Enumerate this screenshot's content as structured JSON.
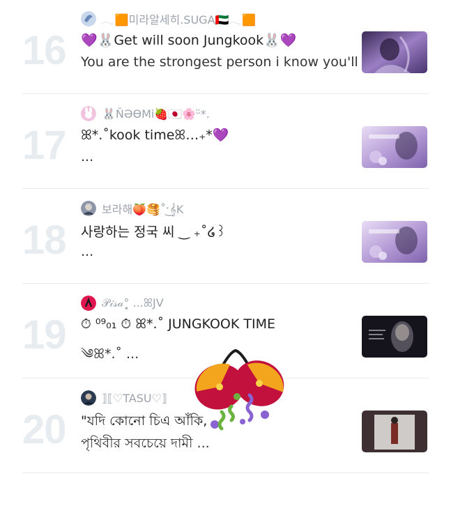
{
  "posts": [
    {
      "rank": "16",
      "author": "𓂃🟧미라알세히.SUGA🇦🇪𓂃🟧",
      "title": "💜🐰Get will soon Jungkook🐰💜",
      "snippet": "You are the strongest person i know you'll ...",
      "avatar_color": "#c9d7ec",
      "thumb_color": "#7b5fa0"
    },
    {
      "rank": "17",
      "author": "🐰ŇӘƟMi🍓🇯🇵🌸ᵕ̈*.",
      "title": "ꕤ*.˚kook  timeꕤ…₊*💜",
      "snippet": "...",
      "avatar_color": "#f1c3de",
      "thumb_color": "#b79ed7"
    },
    {
      "rank": "18",
      "author": "보라해🍑🥞˚ˑ͜𝄞K",
      "title": "사랑하는 정국 씨 ‿ ₊˚໒꒱",
      "snippet": "...",
      "avatar_color": "#8d95a8",
      "thumb_color": "#b79ed7"
    },
    {
      "rank": "19",
      "author": "𝒫𝒾𝓈𝒶°̥̥̥̥ ...ꕤJV",
      "title": "⏱ ⁰⁹₀₁ ⏱ ꕤ*.˚ JUNGKOOK TIME",
      "snippet": "༄ꕤ*.˚ ...",
      "avatar_color": "#e0164f",
      "thumb_color": "#1a1822"
    },
    {
      "rank": "20",
      "author": "⟧⟦♡TASU♡⟧",
      "title": "\"যদি কোনো চিএ আঁকি,",
      "snippet": "পৃথিবীর সবচেয়ে দামী ...",
      "avatar_color": "#2a3a50",
      "thumb_color": "#5c3f3a"
    }
  ],
  "overlay": {
    "icon": "party-popper-icon"
  },
  "colors": {
    "rank_numeral": "#e7ecf0",
    "divider": "#e8eaec"
  }
}
